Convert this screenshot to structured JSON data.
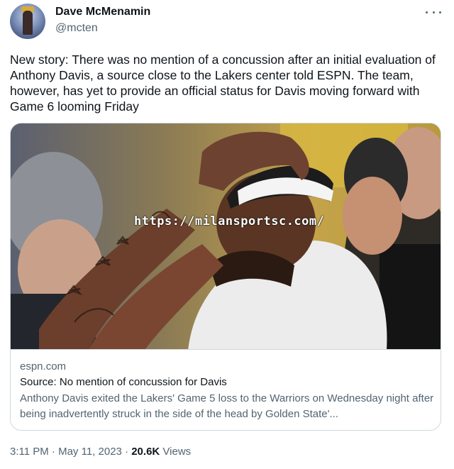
{
  "author": {
    "name": "Dave McMenamin",
    "handle": "@mcten"
  },
  "tweet": {
    "text": "New story: There was no mention of a concussion after an initial evaluation of Anthony Davis, a source close to the Lakers center told ESPN. The team, however, has yet to provide an official status for Davis moving forward with Game 6 looming Friday"
  },
  "card": {
    "image_watermark": "https://milansportsc.com/",
    "domain": "espn.com",
    "title": "Source: No mention of concussion for Davis",
    "description": "Anthony Davis exited the Lakers' Game 5 loss to the Warriors on Wednesday night after being inadvertently struck in the side of the head by Golden State'..."
  },
  "meta": {
    "time": "3:11 PM",
    "separator": "·",
    "date": "May 11, 2023",
    "views_count": "20.6K",
    "views_label": "Views"
  },
  "icons": {
    "more": "more-horizontal-icon"
  }
}
